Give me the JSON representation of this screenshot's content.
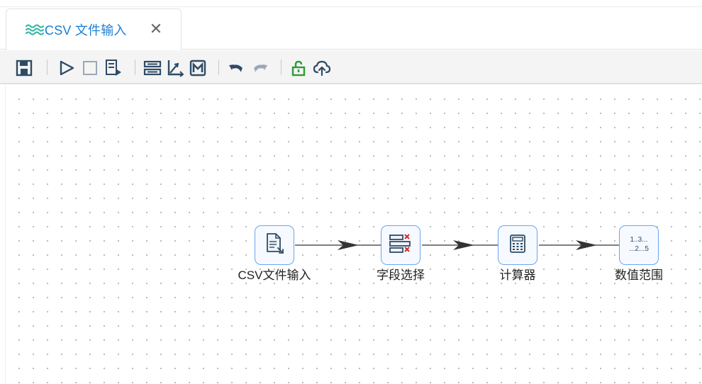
{
  "tab": {
    "label": "CSV 文件输入",
    "close": "✕",
    "icon": "waves-icon"
  },
  "toolbar": {
    "items": [
      "save-icon",
      "run-icon",
      "stop-icon",
      "preview-icon",
      "align-icon",
      "axis-icon",
      "m-icon",
      "undo-icon",
      "redo-icon",
      "unlock-icon",
      "upload-cloud-icon"
    ]
  },
  "colors": {
    "accent": "#1a7fd6",
    "tab_icon": "#3cb7a7",
    "toolbar_icon": "#2e4b66",
    "node_border": "#6aa6f0",
    "unlock": "#2e9b3a"
  },
  "flow": {
    "nodes": [
      {
        "id": "csv",
        "label": "CSV文件输入",
        "icon": "file-import-icon"
      },
      {
        "id": "select",
        "label": "字段选择",
        "icon": "field-select-icon"
      },
      {
        "id": "calc",
        "label": "计算器",
        "icon": "calculator-icon"
      },
      {
        "id": "range",
        "label": "数值范围",
        "icon": "number-range-icon",
        "icon_text_1": "1..3...",
        "icon_text_2": "...2...5"
      }
    ]
  }
}
